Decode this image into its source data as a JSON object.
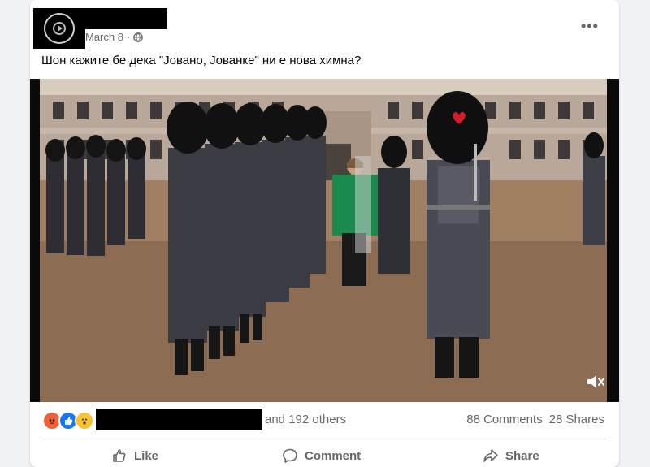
{
  "post": {
    "date": "March 8",
    "privacy_icon": "globe-icon",
    "more_label": "•••",
    "text": "Шон кажите бе дека \"Јовано, Јованке\" ни е нова химна?"
  },
  "reactions": {
    "icons": [
      "angry-react-icon",
      "like-react-icon",
      "wow-react-icon"
    ],
    "others_text": "and 192 others",
    "comments": "88 Comments",
    "shares": "28 Shares"
  },
  "actions": {
    "like": "Like",
    "comment": "Comment",
    "share": "Share"
  },
  "colors": {
    "accent": "#1877f2",
    "muted_text": "#65676b"
  }
}
